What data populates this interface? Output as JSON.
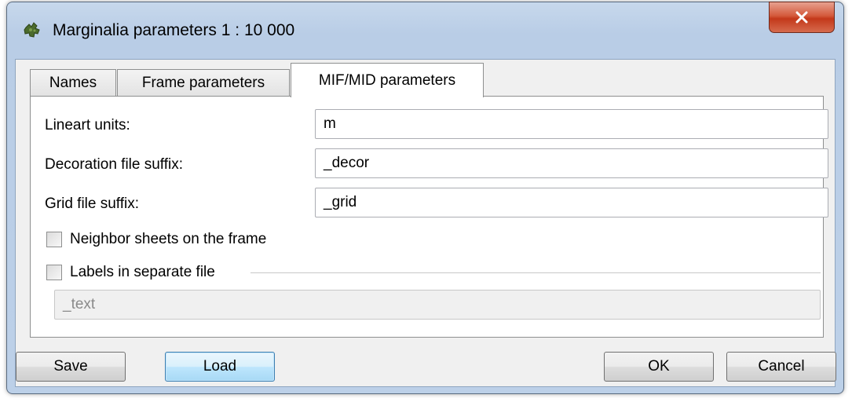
{
  "window": {
    "title": "Marginalia parameters 1 : 10 000",
    "icon": "puzzle-icon",
    "close_glyph": "✕"
  },
  "tabs": [
    {
      "label": "Names",
      "active": false
    },
    {
      "label": "Frame parameters",
      "active": false
    },
    {
      "label": "MIF/MID parameters",
      "active": true
    }
  ],
  "fields": {
    "lineart_units": {
      "label": "Lineart units:",
      "value": "m"
    },
    "decoration_suffix": {
      "label": "Decoration file suffix:",
      "value": "_decor"
    },
    "grid_suffix": {
      "label": "Grid file suffix:",
      "value": "_grid"
    }
  },
  "checkboxes": {
    "neighbor_sheets": {
      "label": "Neighbor sheets on the frame",
      "checked": false
    },
    "labels_separate": {
      "label": "Labels in separate file",
      "checked": false
    }
  },
  "labels_file": {
    "value": "_text",
    "disabled": true
  },
  "buttons": {
    "save": "Save",
    "load": "Load",
    "ok": "OK",
    "cancel": "Cancel"
  },
  "colors": {
    "close_button": "#c3381a",
    "focused_button": "#3c7fb1",
    "window_frame": "#b9cde6"
  }
}
